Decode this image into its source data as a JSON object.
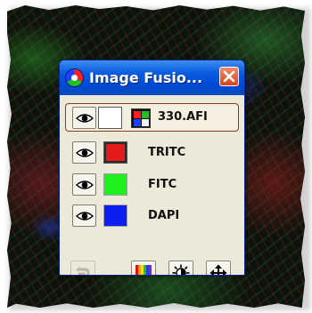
{
  "window": {
    "title": "Image Fusio...",
    "icon": "rgb-fusion-icon",
    "close_icon": "close-icon"
  },
  "channels": [
    {
      "label": "330.AFI",
      "visible": true,
      "color": "#ffffff",
      "selected": true
    },
    {
      "label": "TRITC",
      "visible": true,
      "color": "#e41b1b",
      "selected": false
    },
    {
      "label": "FITC",
      "visible": true,
      "color": "#1ef01e",
      "selected": false
    },
    {
      "label": "DAPI",
      "visible": true,
      "color": "#0c1ef0",
      "selected": false
    }
  ],
  "lut_button": {
    "icon": "color-lut-grid-icon",
    "colors": [
      "#ff2020",
      "#20c020",
      "#2040ff",
      "#f0f0f0"
    ]
  },
  "toolbar": {
    "buttons": [
      {
        "icon": "undo-arrow-icon",
        "enabled": false
      },
      {
        "icon": "color-spectrum-icon",
        "enabled": true
      },
      {
        "icon": "brightness-contrast-icon",
        "enabled": true
      },
      {
        "icon": "move-arrows-icon",
        "enabled": true
      }
    ]
  },
  "colors": {
    "titlebar": "#0a5de0",
    "window_bg": "#ece9d8",
    "selection_border": "#8a3a1c"
  }
}
